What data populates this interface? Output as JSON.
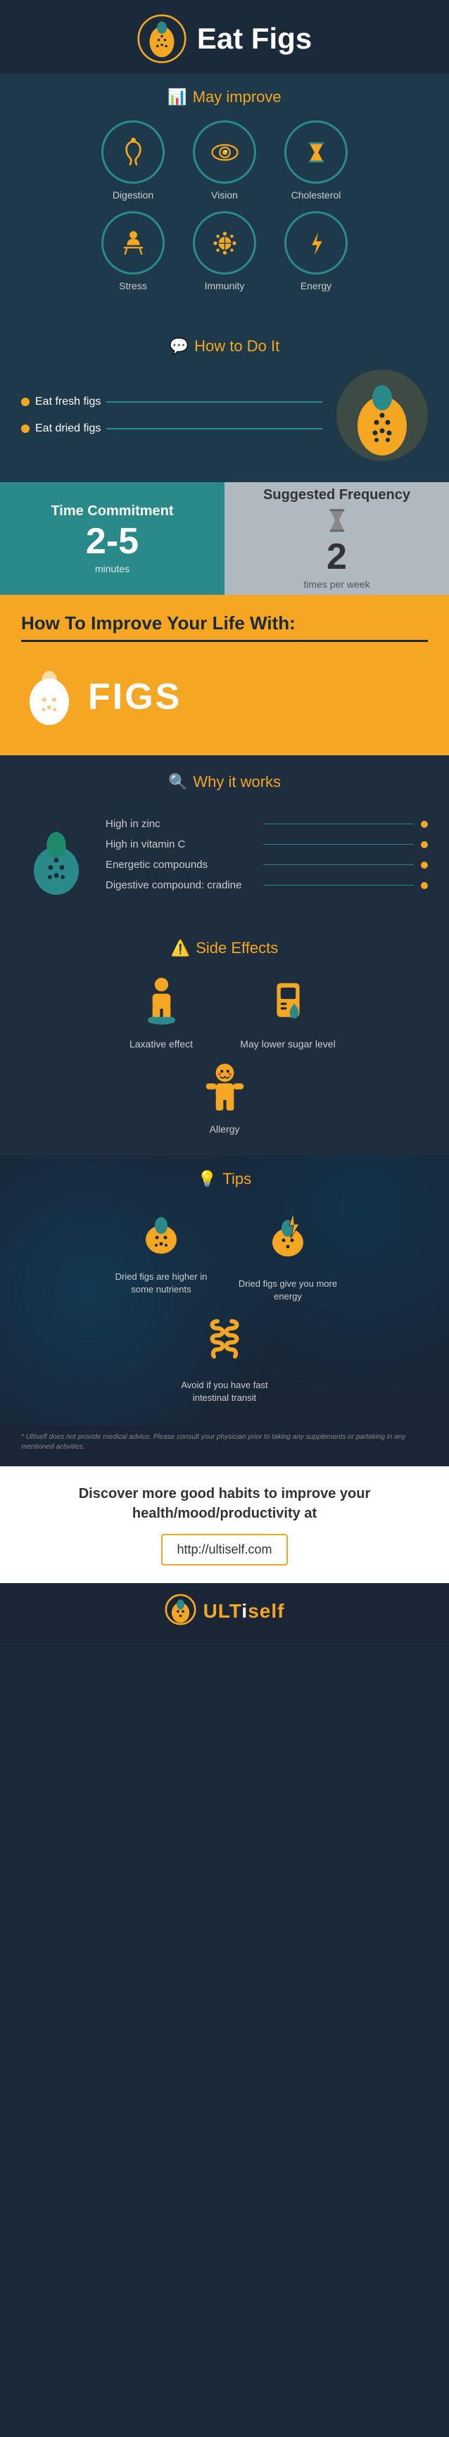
{
  "header": {
    "title": "Eat Figs",
    "icon": "🫐"
  },
  "may_improve": {
    "section_title": "May improve",
    "items": [
      {
        "label": "Digestion",
        "icon": "🫁"
      },
      {
        "label": "Vision",
        "icon": "👁"
      },
      {
        "label": "Cholesterol",
        "icon": "⏳"
      },
      {
        "label": "Stress",
        "icon": "🧘"
      },
      {
        "label": "Immunity",
        "icon": "🦠"
      },
      {
        "label": "Energy",
        "icon": "⚡"
      }
    ]
  },
  "how_to": {
    "section_title": "How to Do It",
    "steps": [
      {
        "text": "Eat fresh figs"
      },
      {
        "text": "Eat dried figs"
      }
    ]
  },
  "time_commitment": {
    "label": "Time Commitment",
    "value": "2-5",
    "unit": "minutes"
  },
  "suggested_frequency": {
    "label": "Suggested Frequency",
    "value": "2",
    "unit": "times per week"
  },
  "improve_banner": {
    "line1": "How To Improve Your Life With:",
    "subject": "FIGS"
  },
  "why_it_works": {
    "section_title": "Why it works",
    "items": [
      {
        "text": "High in zinc"
      },
      {
        "text": "High in vitamin C"
      },
      {
        "text": "Energetic compounds"
      },
      {
        "text": "Digestive compound: cradine"
      }
    ]
  },
  "side_effects": {
    "section_title": "Side Effects",
    "items": [
      {
        "label": "Laxative effect",
        "icon": "🚽"
      },
      {
        "label": "May lower sugar level",
        "icon": "💉"
      },
      {
        "label": "Allergy",
        "icon": "🤧"
      }
    ]
  },
  "tips": {
    "section_title": "Tips",
    "items": [
      {
        "label": "Dried figs are higher in some nutrients",
        "icon": "🫐"
      },
      {
        "label": "Dried figs give you more energy",
        "icon": "🫐"
      },
      {
        "label": "Avoid if you have fast intestinal transit",
        "icon": "🫁"
      }
    ]
  },
  "disclaimer": {
    "text": "* Ultiself does not provide medical advice. Please consult your physician prior to taking any supplements or partaking in any mentioned activities."
  },
  "discover": {
    "text": "Discover more good habits to improve your health/mood/productivity at",
    "link": "http://ultiself.com"
  },
  "footer": {
    "brand": "ULTiself"
  },
  "colors": {
    "orange": "#f5a623",
    "teal": "#2a8a8a",
    "dark_bg": "#1e3a4a",
    "darker_bg": "#1a2535"
  }
}
